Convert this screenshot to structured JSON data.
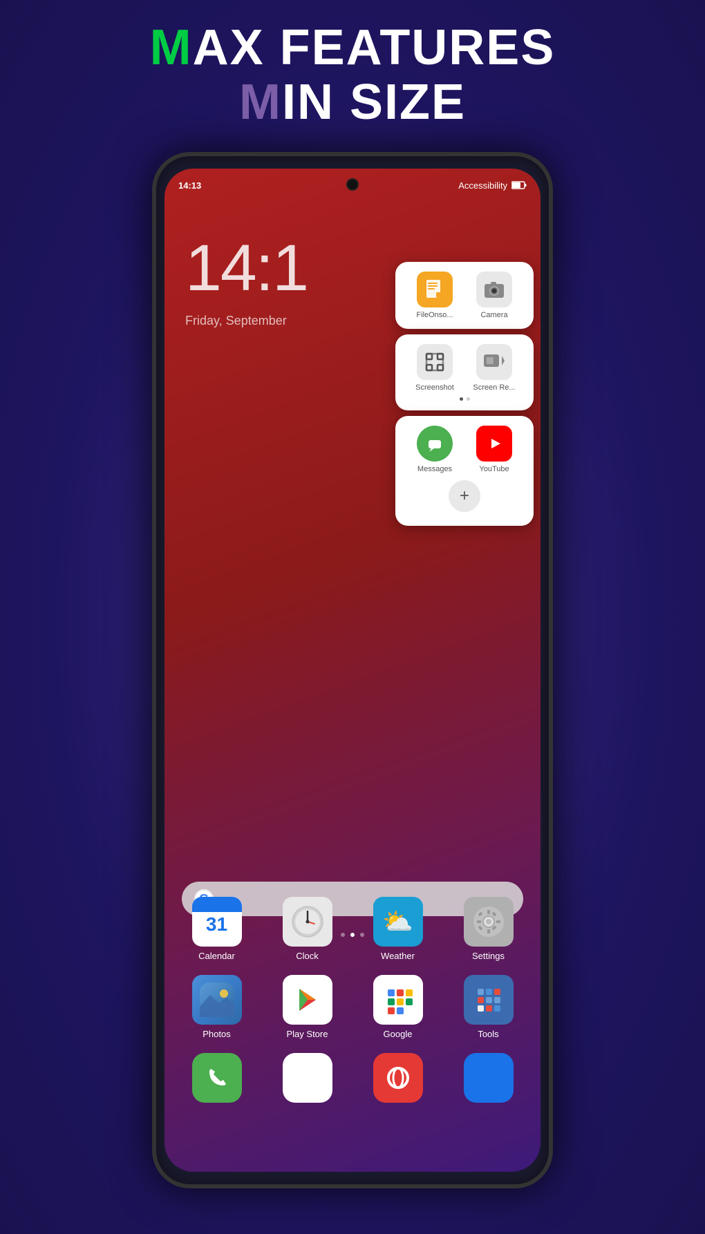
{
  "header": {
    "line1_prefix": "AX FEATURES",
    "line1_m": "M",
    "line2_prefix": "IN SIZE",
    "line2_m": "M"
  },
  "statusBar": {
    "time": "14:13",
    "right": "Accessibility"
  },
  "screenClock": "14:1",
  "screenDate": "Friday, September",
  "floatingPanel": {
    "cards": [
      {
        "icons": [
          {
            "label": "FileOnso...",
            "type": "file-console"
          },
          {
            "label": "Camera",
            "type": "camera"
          }
        ]
      },
      {
        "icons": [
          {
            "label": "Screenshot",
            "type": "screenshot"
          },
          {
            "label": "Screen Re...",
            "type": "screen-record"
          }
        ],
        "hasDots": true
      },
      {
        "icons": [
          {
            "label": "Messages",
            "type": "messages"
          },
          {
            "label": "YouTube",
            "type": "youtube"
          }
        ],
        "hasPlus": true
      }
    ]
  },
  "appGrid": {
    "row1": [
      {
        "label": "Calendar",
        "type": "calendar",
        "num": "31"
      },
      {
        "label": "Clock",
        "type": "clock"
      },
      {
        "label": "Weather",
        "type": "weather"
      },
      {
        "label": "Settings",
        "type": "settings"
      }
    ],
    "row2": [
      {
        "label": "Photos",
        "type": "photos"
      },
      {
        "label": "Play Store",
        "type": "playstore"
      },
      {
        "label": "Google",
        "type": "google"
      },
      {
        "label": "Tools",
        "type": "tools"
      }
    ]
  },
  "dots": {
    "count": 3,
    "active": 1
  }
}
